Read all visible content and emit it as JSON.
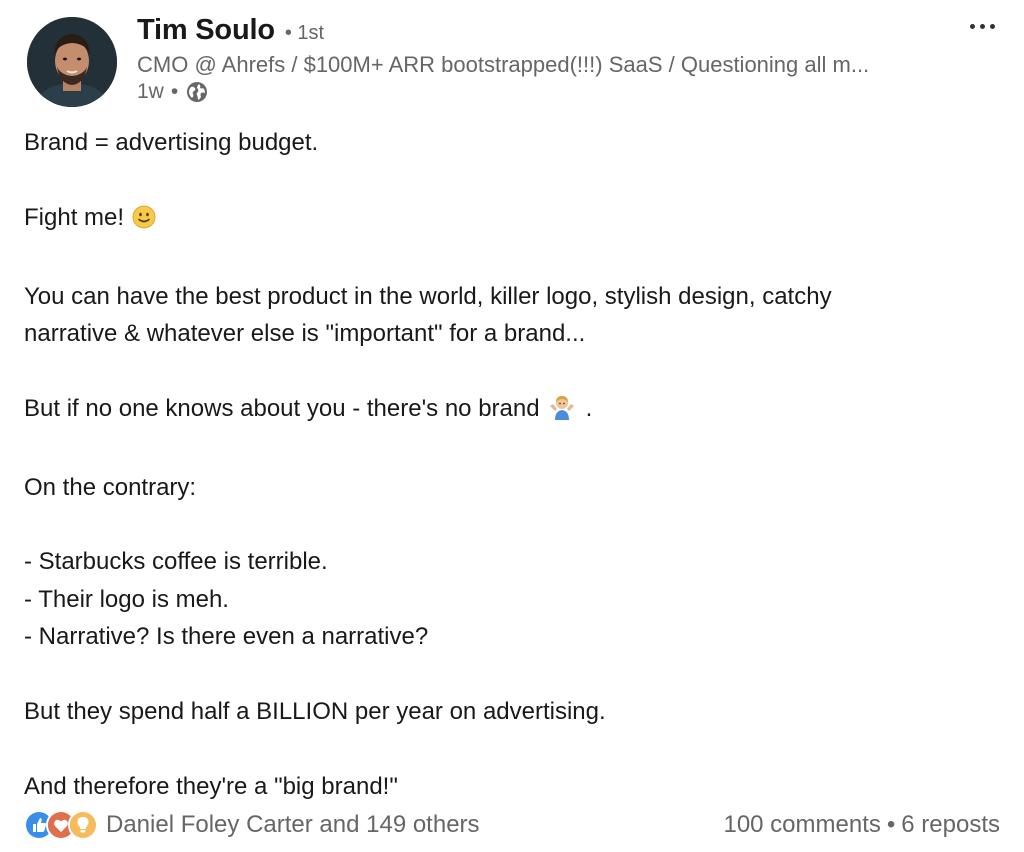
{
  "author": {
    "name": "Tim Soulo",
    "degree": "1st",
    "headline": "CMO @ Ahrefs / $100M+ ARR bootstrapped(!!!) SaaS / Questioning all m...",
    "time_ago": "1w",
    "visibility_icon": "globe-icon"
  },
  "post": {
    "lines": [
      "Brand = advertising budget.",
      "",
      "Fight me!",
      "",
      "You can have the best product in the world, killer logo, stylish design, catchy",
      "narrative & whatever else is \"important\" for a brand...",
      "",
      "But if no one knows about you - there's no brand",
      "",
      "On the contrary:",
      "",
      "- Starbucks coffee is terrible.",
      "- Their logo is meh.",
      "- Narrative? Is there even a narrative?",
      "",
      "But they spend half a BILLION per year on advertising.",
      "",
      "And therefore they're a \"big brand!\""
    ],
    "shrug_suffix": "."
  },
  "social": {
    "reactions_text": "Daniel Foley Carter and 149 others",
    "comments": "100 comments",
    "separator": "•",
    "reposts": "6 reposts",
    "reaction_icons": [
      "like-icon",
      "love-icon",
      "insightful-icon"
    ]
  },
  "colors": {
    "text_primary": "#191919",
    "text_secondary": "#666666",
    "like_blue": "#378fe9",
    "love_red": "#df704d",
    "insightful_yellow": "#f5bb5c"
  }
}
